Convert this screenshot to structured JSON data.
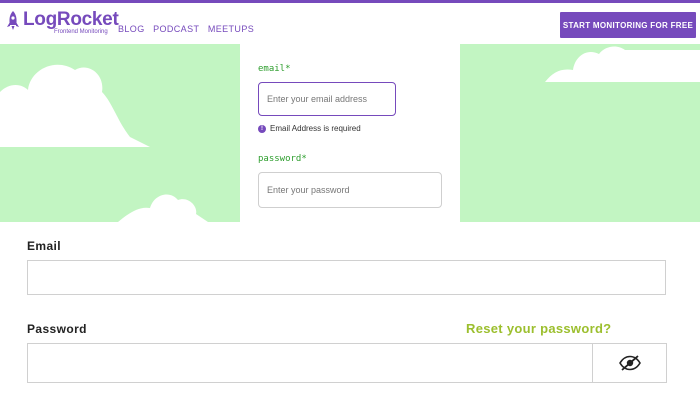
{
  "brand": {
    "name": "LogRocket",
    "tagline": "Frontend Monitoring",
    "color": "#764abc"
  },
  "nav": {
    "items": [
      "BLOG",
      "PODCAST",
      "MEETUPS"
    ]
  },
  "cta": {
    "label": "START MONITORING FOR FREE"
  },
  "embedded_form": {
    "email_label": "email",
    "email_required_mark": "*",
    "email_placeholder": "Enter your email address",
    "email_error": "Email Address is required",
    "password_label": "password",
    "password_required_mark": "*",
    "password_placeholder": "Enter your password",
    "label_color": "#2e9e2e",
    "background_color": "#c2f5c2"
  },
  "login_form": {
    "email_label": "Email",
    "password_label": "Password",
    "reset_link": "Reset your password?",
    "reset_color": "#9cbf2e",
    "toggle_icon": "eye-slash-icon"
  }
}
